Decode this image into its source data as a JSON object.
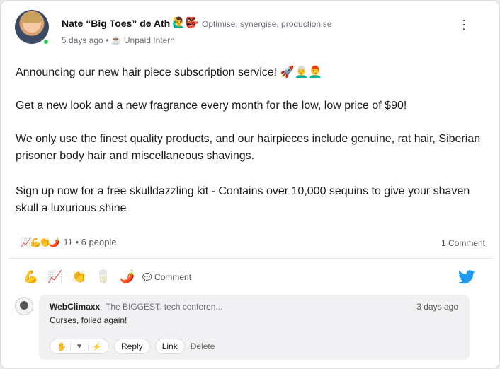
{
  "post": {
    "author": {
      "name": "Nate “Big Toes” de Ath",
      "name_emoji": "🙋‍♂️👺",
      "tagline": "Optimise, synergise, productionise",
      "time": "5 days ago",
      "role": "☕ Unpaid Intern"
    },
    "paragraphs": [
      "Announcing our new hair piece subscription service! 🚀👨‍🦳👨‍🦰",
      "Get a new look and a new fragrance every month for the low, low price of $90!",
      "We only use the finest quality products, and our hairpieces include genuine, rat hair, Siberian prisoner body hair and miscellaneous shavings.",
      "Sign up now for a free skulldazzling kit - Contains over 10,000 sequins to give your shaven skull a luxurious shine"
    ],
    "reactions": {
      "emojis": "📈💪👏🌶️",
      "count": "11",
      "people": "• 6 people"
    },
    "comment_count": "1 Comment",
    "actions": {
      "reaction_buttons": [
        "💪",
        "📈",
        "👏",
        "🥛",
        "🌶️"
      ],
      "comment_icon": "💬",
      "comment_label": "Comment"
    },
    "comments": [
      {
        "author": "WebClimaxx",
        "tagline": "The BIGGEST. tech conferen...",
        "time": "3 days ago",
        "text": "Curses, foiled again!",
        "react_icons": [
          "✋",
          "♥",
          "⚡"
        ],
        "reply_label": "Reply",
        "link_label": "Link",
        "delete_label": "Delete"
      }
    ]
  },
  "colors": {
    "accent_twitter": "#1d9bf0",
    "online": "#2ec25a"
  }
}
